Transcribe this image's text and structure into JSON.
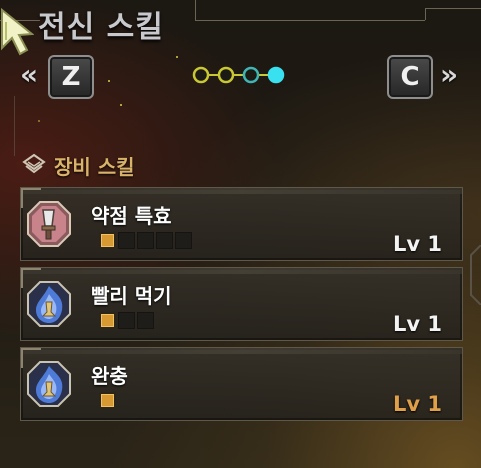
{
  "panel": {
    "title": "전신 스킬",
    "nav": {
      "prev_glyph": "«",
      "next_glyph": "»",
      "prev_key": "Z",
      "next_key": "C",
      "pages_total": 4,
      "current_page": 4
    }
  },
  "section": {
    "title": "장비 스킬",
    "icon": "layered-diamond-icon"
  },
  "skills": [
    {
      "name": "약점 특효",
      "icon": "weapon-octagon-icon",
      "icon_color": "#c9838a",
      "level_text": "Lv 1",
      "level": 1,
      "max_level": 5,
      "level_color": "#f3f3f3"
    },
    {
      "name": "빨리 먹기",
      "icon": "blue-flame-icon",
      "icon_color": "#4f7bd8",
      "level_text": "Lv 1",
      "level": 1,
      "max_level": 3,
      "level_color": "#f3f3f3"
    },
    {
      "name": "완충",
      "icon": "blue-flame-icon",
      "icon_color": "#4f7bd8",
      "level_text": "Lv 1",
      "level": 1,
      "max_level": 1,
      "level_color": "#e0a04a"
    }
  ],
  "colors": {
    "dot_inactive": "#c8c832",
    "dot_mid": "#3fb5b5",
    "dot_active": "#38e0f0",
    "pip_filled": "#d79a33",
    "section_title": "#d9b36a"
  }
}
